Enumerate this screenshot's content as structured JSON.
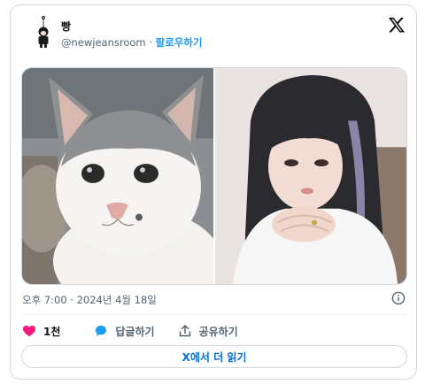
{
  "author": {
    "name": "빵",
    "handle": "@newjeansroom",
    "separator": "·",
    "follow_label": "팔로우하기"
  },
  "icons": {
    "brand": "x-logo-icon",
    "info": "info-icon",
    "like": "heart-icon",
    "reply": "speech-bubble-icon",
    "share": "share-upload-icon"
  },
  "media": {
    "photos": [
      "cat-photo",
      "person-photo"
    ]
  },
  "meta": {
    "timestamp": "오후 7:00 · 2024년 4월 18일"
  },
  "actions": {
    "like_count": "1천",
    "reply_label": "답글하기",
    "share_label": "공유하기"
  },
  "read_more_label": "X에서 더 읽기",
  "colors": {
    "like": "#f91880",
    "reply": "#1d9bf0",
    "link": "#1d9bf0",
    "muted": "#536471",
    "border": "#cfd9de"
  }
}
